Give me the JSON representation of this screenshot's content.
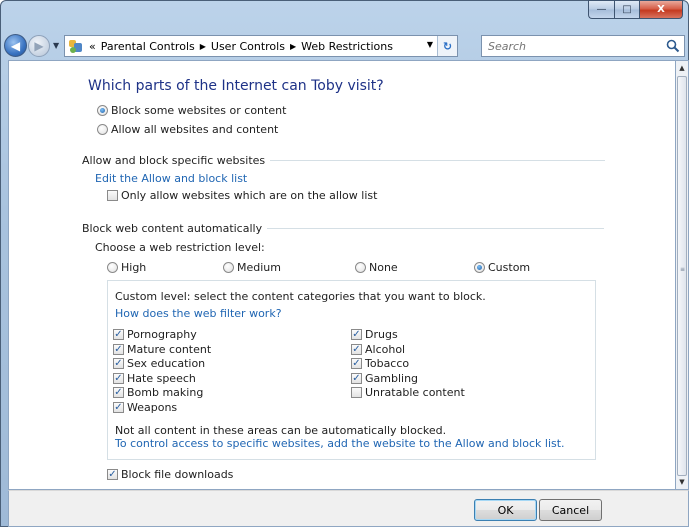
{
  "window": {
    "minimize_glyph": "—",
    "maximize_glyph": "□",
    "close_glyph": "X"
  },
  "nav": {
    "breadcrumb_prefix": "«",
    "breadcrumbs": [
      "Parental Controls",
      "User Controls",
      "Web Restrictions"
    ],
    "search_placeholder": "Search"
  },
  "page": {
    "heading": "Which parts of the Internet can Toby visit?",
    "scope_options": [
      {
        "label": "Block some websites or content",
        "selected": true
      },
      {
        "label": "Allow all websites and content",
        "selected": false
      }
    ],
    "allow_block_section": {
      "title": "Allow and block specific websites",
      "edit_link": "Edit the Allow and block list",
      "only_allow_label": "Only allow websites which are on the allow list",
      "only_allow_checked": false
    },
    "auto_block_section": {
      "title": "Block web content automatically",
      "level_prompt": "Choose a web restriction level:",
      "levels": [
        {
          "label": "High",
          "selected": false
        },
        {
          "label": "Medium",
          "selected": false
        },
        {
          "label": "None",
          "selected": false
        },
        {
          "label": "Custom",
          "selected": true
        }
      ],
      "custom_intro": "Custom level:  select the content categories that you want to block.",
      "filter_link": "How does the web filter work?",
      "categories_left": [
        {
          "label": "Pornography",
          "checked": true
        },
        {
          "label": "Mature content",
          "checked": true
        },
        {
          "label": "Sex education",
          "checked": true
        },
        {
          "label": "Hate speech",
          "checked": true
        },
        {
          "label": "Bomb making",
          "checked": true
        },
        {
          "label": "Weapons",
          "checked": true
        }
      ],
      "categories_right": [
        {
          "label": "Drugs",
          "checked": true
        },
        {
          "label": "Alcohol",
          "checked": true
        },
        {
          "label": "Tobacco",
          "checked": true
        },
        {
          "label": "Gambling",
          "checked": true
        },
        {
          "label": "Unratable content",
          "checked": false
        }
      ],
      "note": "Not all content in these areas can be automatically blocked.",
      "note_link": "To control access to specific websites, add the website to the Allow and block list."
    },
    "block_downloads_label": "Block file downloads",
    "block_downloads_checked": true
  },
  "buttons": {
    "ok": "OK",
    "cancel": "Cancel"
  },
  "colors": {
    "heading": "#1e3287",
    "link": "#2066b3",
    "frame": "#a9c3de"
  }
}
